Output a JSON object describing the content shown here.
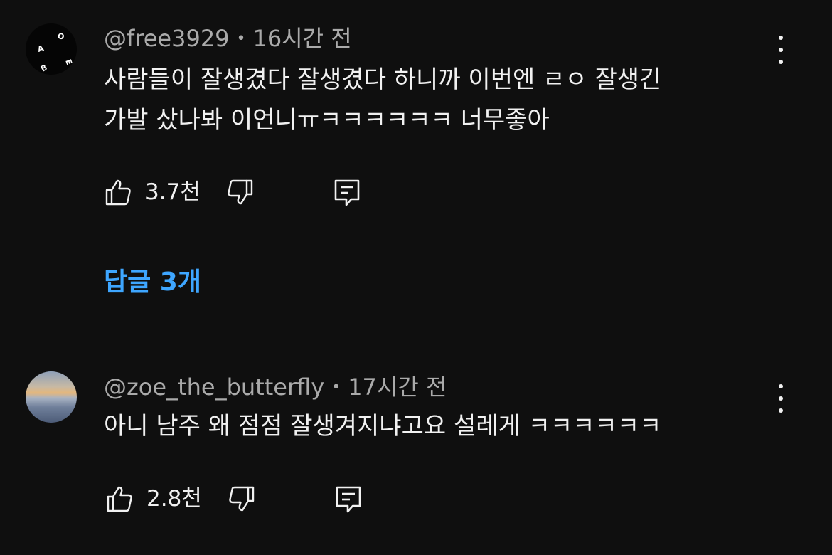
{
  "comments": [
    {
      "author": "@free3929",
      "time": "16시간 전",
      "separator": "•",
      "text_line1": "사람들이 잘생겼다 잘생겼다 하니까 이번엔 ㄹㅇ 잘생긴",
      "text_line2": "가발 샀나봐 이언니ㅠㅋㅋㅋㅋㅋㅋ 너무좋아",
      "likes": "3.7천",
      "avatar_letters": [
        "O",
        "A",
        "E",
        "B"
      ]
    },
    {
      "author": "@zoe_the_butterfly",
      "time": "17시간 전",
      "separator": "•",
      "text_line1": "아니 남주 왜 점점 잘생겨지냐고요 설레게 ㅋㅋㅋㅋㅋㅋ",
      "likes": "2.8천"
    }
  ],
  "replies_link": "답글 3개",
  "colors": {
    "background": "#0f0f0f",
    "text": "#f1f1f1",
    "meta": "#aaaaaa",
    "link": "#3ea6ff"
  },
  "icons": [
    "like-icon",
    "dislike-icon",
    "reply-icon",
    "more-vert-icon"
  ]
}
